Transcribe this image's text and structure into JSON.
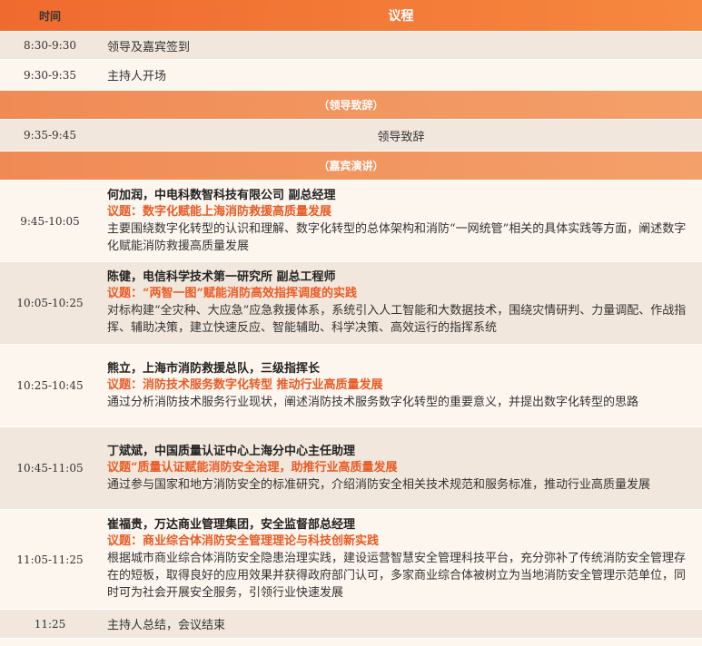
{
  "header": {
    "time_label": "时间",
    "agenda_label": "议程"
  },
  "colors": {
    "accent": "#ef6a2e",
    "topic": "#ea5a23",
    "row_shade": "#f2e7dc",
    "row_light": "#fdf6ef"
  },
  "rows": [
    {
      "time": "8:30-9:30",
      "text": "领导及嘉宾签到"
    },
    {
      "time": "9:30-9:35",
      "text": "主持人开场"
    }
  ],
  "section1": {
    "label": "（领导致辞）"
  },
  "speech": {
    "time": "9:35-9:45",
    "text": "领导致辞"
  },
  "section2": {
    "label": "（嘉宾演讲）"
  },
  "talks": [
    {
      "time": "9:45-10:05",
      "speaker": "何加润，中电科数智科技有限公司 副总经理",
      "topic": "议题：数字化赋能上海消防救援高质量发展",
      "desc": "主要围绕数字化转型的认识和理解、数字化转型的总体架构和消防“一网统管”相关的具体实践等方面，阐述数字化赋能消防救援高质量发展"
    },
    {
      "time": "10:05-10:25",
      "speaker": "陈健，电信科学技术第一研究所 副总工程师",
      "topic": "议题：“两智一图”赋能消防高效指挥调度的实践",
      "desc": "对标构建“全灾种、大应急”应急救援体系，系统引入人工智能和大数据技术，围绕灾情研判、力量调配、作战指挥、辅助决策，建立快速反应、智能辅助、科学决策、高效运行的指挥系统"
    },
    {
      "time": "10:25-10:45",
      "speaker": "熊立，上海市消防救援总队，三级指挥长",
      "topic": "议题：消防技术服务数字化转型 推动行业高质量发展",
      "desc": "通过分析消防技术服务行业现状，阐述消防技术服务数字化转型的重要意义，并提出数字化转型的思路"
    },
    {
      "time": "10:45-11:05",
      "speaker": "丁斌斌，中国质量认证中心上海分中心主任助理",
      "topic": "议题“质量认证赋能消防安全治理，助推行业高质量发展",
      "desc": "通过参与国家和地方消防安全的标准研究，介绍消防安全相关技术规范和服务标准，推动行业高质量发展"
    },
    {
      "time": "11:05-11:25",
      "speaker": "崔福贵，万达商业管理集团，安全监督部总经理",
      "topic": "议题：商业综合体消防安全管理理论与科技创新实践",
      "desc": "根据城市商业综合体消防安全隐患治理实践，建设运营智慧安全管理科技平台，充分弥补了传统消防安全管理存在的短板，取得良好的应用效果并获得政府部门认可，多家商业综合体被树立为当地消防安全管理示范单位，同时可为社会开展安全服务，引领行业快速发展"
    }
  ],
  "closing": {
    "time": "11:25",
    "text": "主持人总结，会议结束"
  }
}
